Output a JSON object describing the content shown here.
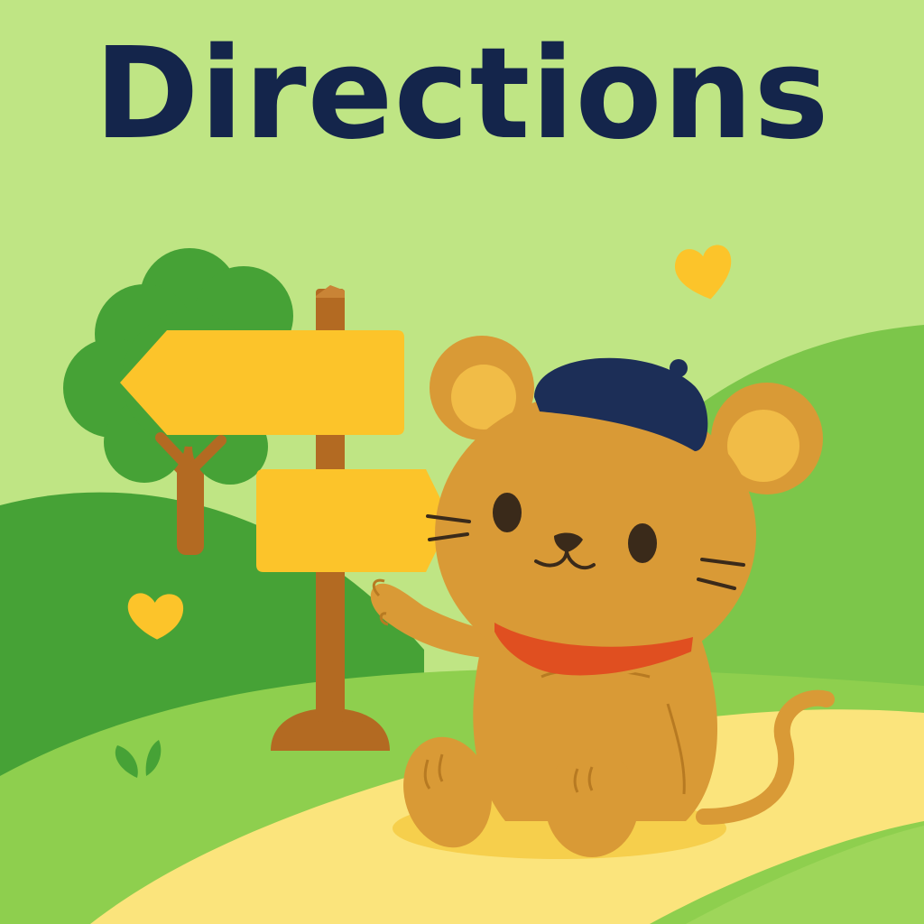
{
  "title": "Directions",
  "colors": {
    "sky": "#bfe584",
    "hill_dark": "#49a33a",
    "hill_light": "#7cc64a",
    "path": "#fbe47c",
    "sign_yellow": "#fcc42a",
    "post_brown": "#b36a22",
    "mouse_body": "#d99a36",
    "mouse_ear_inner": "#f1bc47",
    "beret": "#1c2e57",
    "scarf": "#e04f20",
    "title_text": "#14254b"
  },
  "icons": [
    "heart-icon",
    "sprout-icon",
    "signpost",
    "tree",
    "mouse-character"
  ]
}
